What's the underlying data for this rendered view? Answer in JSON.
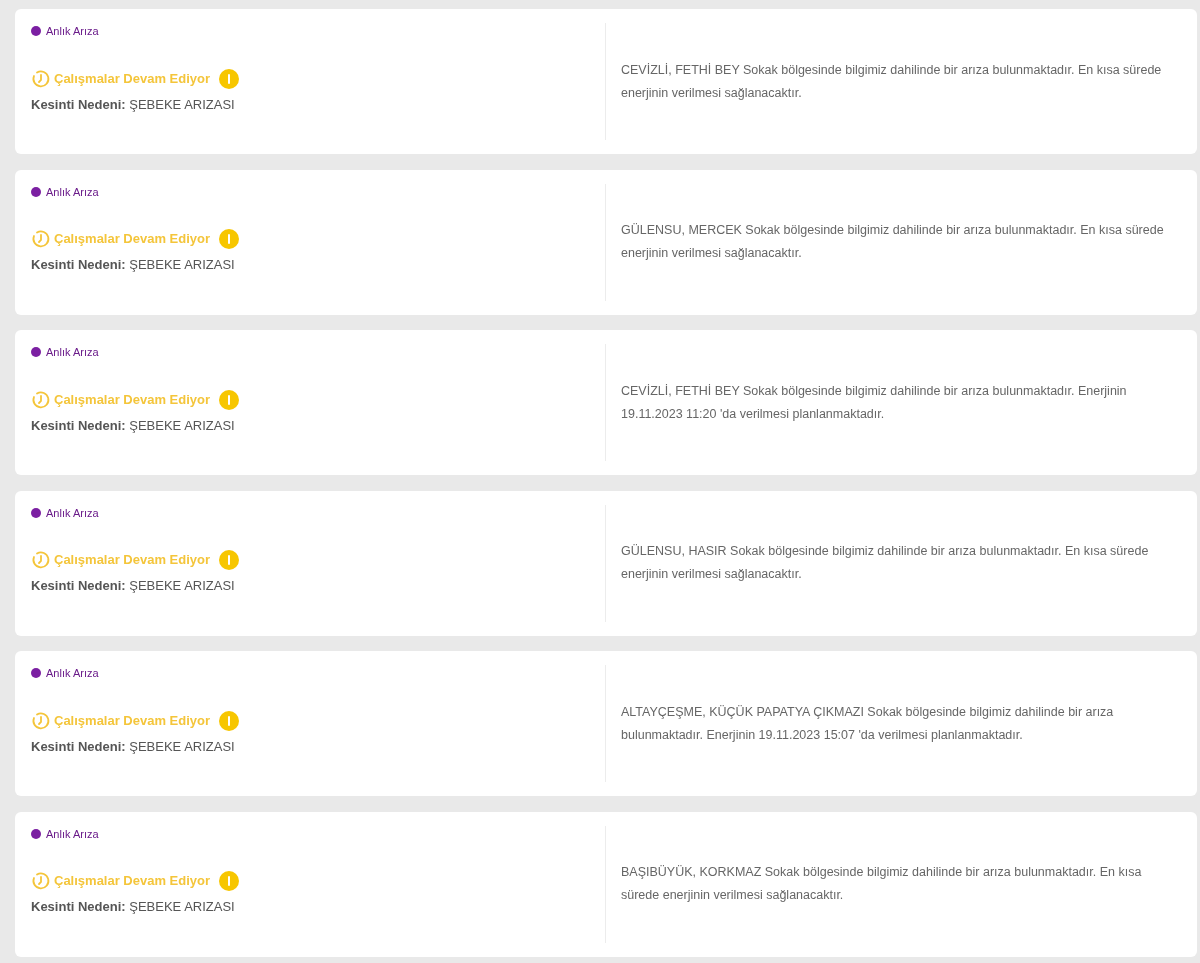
{
  "outages": [
    {
      "type": "Anlık Arıza",
      "status": "Çalışmalar Devam Ediyor",
      "reason_label": "Kesinti Nedeni:",
      "reason": "ŞEBEKE ARIZASI",
      "message": "CEVİZLİ, FETHİ BEY Sokak bölgesinde bilgimiz dahilinde bir arıza bulunmaktadır. En kısa sürede enerjinin verilmesi sağlanacaktır."
    },
    {
      "type": "Anlık Arıza",
      "status": "Çalışmalar Devam Ediyor",
      "reason_label": "Kesinti Nedeni:",
      "reason": "ŞEBEKE ARIZASI",
      "message": "GÜLENSU, MERCEK Sokak bölgesinde bilgimiz dahilinde bir arıza bulunmaktadır. En kısa sürede enerjinin verilmesi sağlanacaktır."
    },
    {
      "type": "Anlık Arıza",
      "status": "Çalışmalar Devam Ediyor",
      "reason_label": "Kesinti Nedeni:",
      "reason": "ŞEBEKE ARIZASI",
      "message": "CEVİZLİ, FETHİ BEY Sokak bölgesinde bilgimiz dahilinde bir arıza bulunmaktadır. Enerjinin 19.11.2023 11:20 'da verilmesi planlanmaktadır."
    },
    {
      "type": "Anlık Arıza",
      "status": "Çalışmalar Devam Ediyor",
      "reason_label": "Kesinti Nedeni:",
      "reason": "ŞEBEKE ARIZASI",
      "message": "GÜLENSU, HASIR Sokak bölgesinde bilgimiz dahilinde bir arıza bulunmaktadır. En kısa sürede enerjinin verilmesi sağlanacaktır."
    },
    {
      "type": "Anlık Arıza",
      "status": "Çalışmalar Devam Ediyor",
      "reason_label": "Kesinti Nedeni:",
      "reason": "ŞEBEKE ARIZASI",
      "message": "ALTAYÇEŞME, KÜÇÜK PAPATYA ÇIKMAZI Sokak bölgesinde bilgimiz dahilinde bir arıza bulunmaktadır. Enerjinin 19.11.2023 15:07 'da verilmesi planlanmaktadır."
    },
    {
      "type": "Anlık Arıza",
      "status": "Çalışmalar Devam Ediyor",
      "reason_label": "Kesinti Nedeni:",
      "reason": "ŞEBEKE ARIZASI",
      "message": "BAŞIBÜYÜK, KORKMAZ Sokak bölgesinde bilgimiz dahilinde bir arıza bulunmaktadır. En kısa sürede enerjinin verilmesi sağlanacaktır."
    }
  ]
}
